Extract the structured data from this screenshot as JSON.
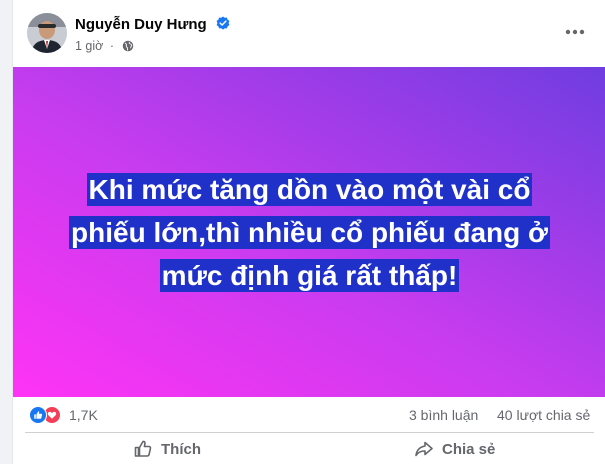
{
  "post": {
    "author": "Nguyễn Duy Hưng",
    "time": "1 giờ",
    "privacy_icon": "globe-icon",
    "verified_icon": "verified-badge-icon",
    "text": "Khi mức tăng dồn vào một vài cổ phiếu lớn,thì nhiều cổ phiếu đang ở mức định giá rất thấp!",
    "background_colors": [
      "#ff33f5",
      "#c83cef",
      "#6f3de0"
    ],
    "text_highlight_color": "#2031c9"
  },
  "stats": {
    "reaction_count": "1,7K",
    "comments": "3 bình luận",
    "shares": "40 lượt chia sẻ"
  },
  "actions": {
    "like_label": "Thích",
    "share_label": "Chia sẻ"
  },
  "colors": {
    "brand_blue": "#1877f2",
    "love_red": "#f33e58",
    "secondary_text": "#65676b"
  }
}
